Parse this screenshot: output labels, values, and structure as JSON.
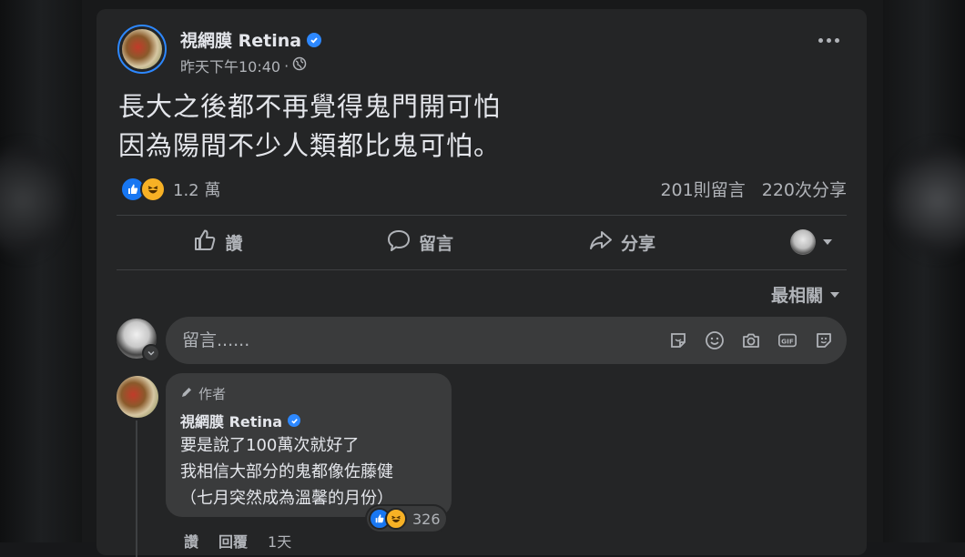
{
  "post": {
    "author": "視網膜 Retina",
    "timestamp": "昨天下午10:40",
    "separator": "·",
    "text_lines": [
      "長大之後都不再覺得鬼門開可怕",
      "因為陽間不少人類都比鬼可怕。"
    ],
    "reaction_count": "1.2 萬",
    "comments_count": "201則留言",
    "shares_count": "220次分享"
  },
  "actions": {
    "like_label": "讚",
    "comment_label": "留言",
    "share_label": "分享"
  },
  "sort": {
    "label": "最相關"
  },
  "composer": {
    "placeholder": "留言......"
  },
  "comment": {
    "author_tag": "作者",
    "author": "視網膜 Retina",
    "lines": [
      "要是說了100萬次就好了",
      "我相信大部分的鬼都像佐藤健",
      "（七月突然成為溫馨的月份）"
    ],
    "reaction_count": "326",
    "like_action": "讚",
    "reply_action": "回覆",
    "time": "1天"
  },
  "colors": {
    "accent": "#2d88ff",
    "like": "#1877f2",
    "haha": "#f7b125",
    "card": "#242526"
  },
  "icons": [
    "verified-badge-icon",
    "globe-icon",
    "more-icon",
    "like-icon",
    "haha-icon",
    "thumbs-up-icon",
    "comment-icon",
    "share-icon",
    "sticker-icon",
    "emoji-icon",
    "camera-icon",
    "gif-icon",
    "avatar-sticker-icon",
    "pencil-icon"
  ]
}
